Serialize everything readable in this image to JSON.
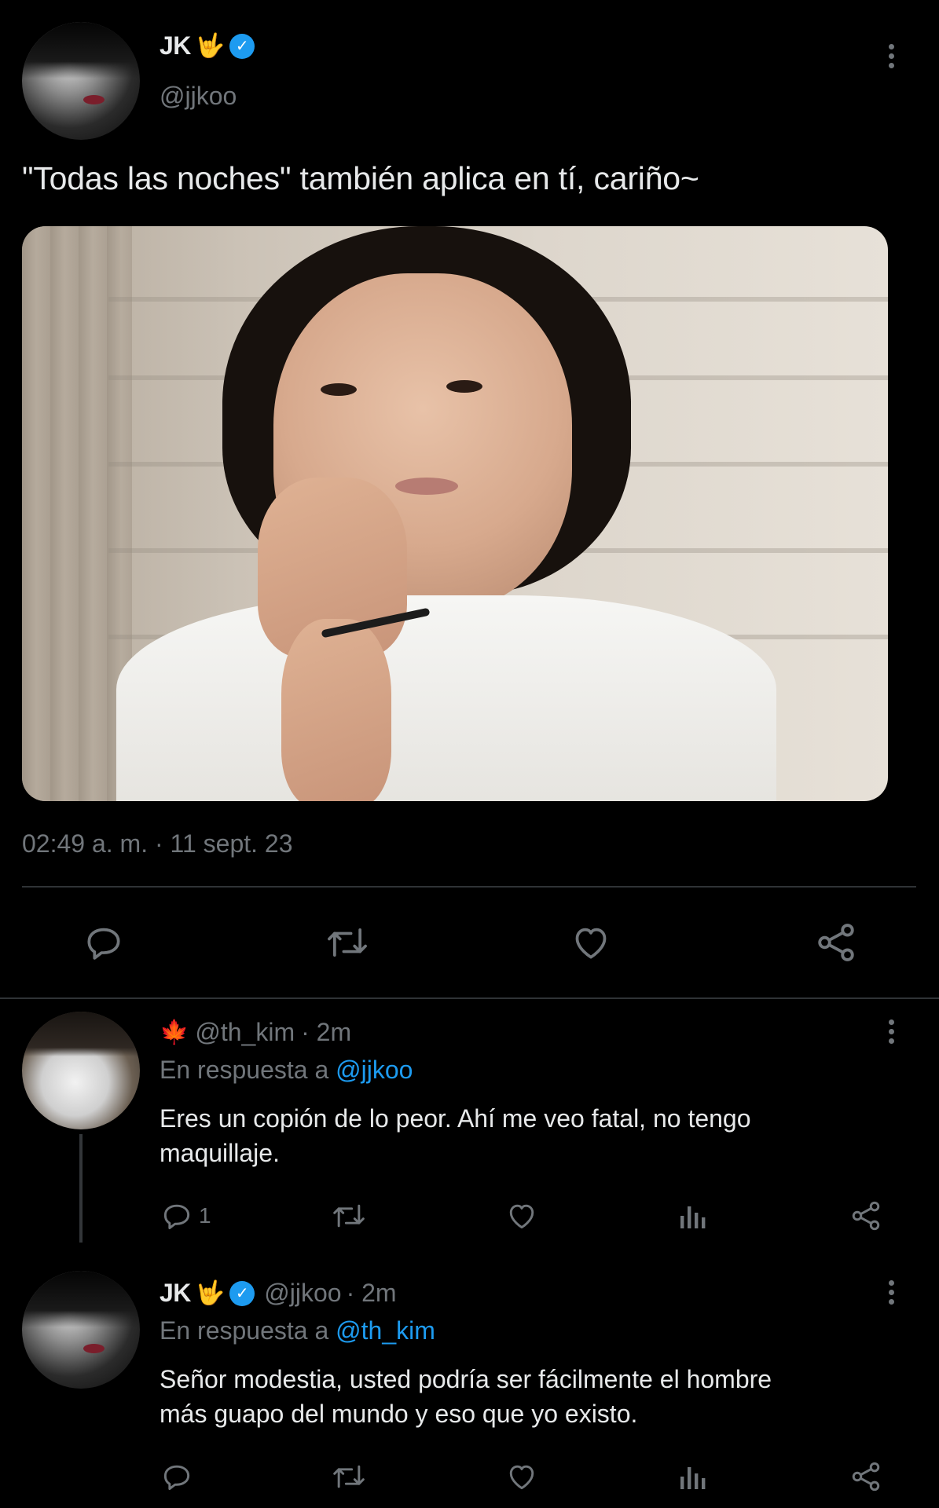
{
  "main_tweet": {
    "author": {
      "display_name": "JK",
      "emoji": "🤟",
      "verified": true,
      "handle": "@jjkoo"
    },
    "text": "\"Todas las noches\" también aplica en tí, cariño~",
    "timestamp": "02:49 a. m. · 11 sept. 23",
    "actions": [
      "reply-icon",
      "retweet-icon",
      "like-icon",
      "share-icon"
    ]
  },
  "replies": [
    {
      "flag_emoji": "🍁",
      "handle": "@th_kim",
      "time": "· 2m",
      "reply_to_prefix": "En respuesta a",
      "reply_to_handle": "@jjkoo",
      "text_line1": "Eres un copión de lo peor. Ahí me veo fatal, no tengo",
      "text_line2": "maquillaje.",
      "reply_count": "1"
    },
    {
      "display_name": "JK",
      "emoji": "🤟",
      "verified": true,
      "handle": "@jjkoo",
      "time": "· 2m",
      "reply_to_prefix": "En respuesta a",
      "reply_to_handle": "@th_kim",
      "text_line1": "Señor modestia, usted podría ser fácilmente el hombre",
      "text_line2": "más guapo del mundo y eso que yo existo."
    }
  ],
  "colors": {
    "background": "#000000",
    "text": "#e7e9ea",
    "secondary": "#71767b",
    "accent": "#1d9bf0",
    "divider": "#2f3336"
  }
}
